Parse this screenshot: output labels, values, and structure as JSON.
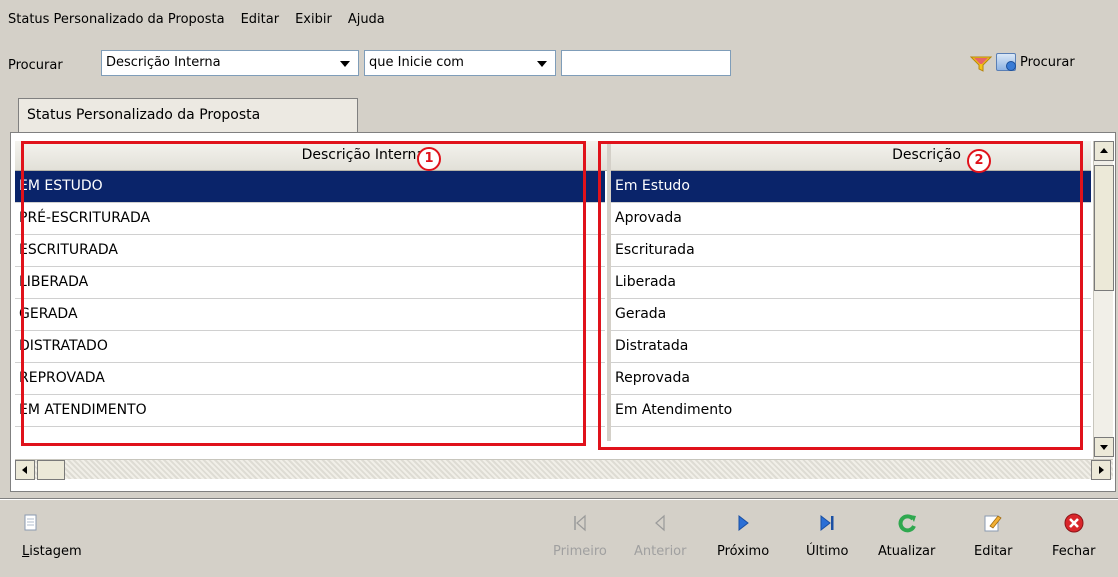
{
  "menu": {
    "items": [
      "Status Personalizado da Proposta",
      "Editar",
      "Exibir",
      "Ajuda"
    ]
  },
  "search": {
    "label": "Procurar",
    "field_value": "Descrição Interna",
    "condition_value": "que Inicie com",
    "text_value": "",
    "button_label": "Procurar"
  },
  "tab": {
    "label": "Status Personalizado da Proposta"
  },
  "table": {
    "columns": [
      "Descrição Interna",
      "Descrição"
    ],
    "rows": [
      [
        "EM ESTUDO",
        "Em Estudo"
      ],
      [
        "PRÉ-ESCRITURADA",
        "Aprovada"
      ],
      [
        "ESCRITURADA",
        "Escriturada"
      ],
      [
        "LIBERADA",
        "Liberada"
      ],
      [
        "GERADA",
        "Gerada"
      ],
      [
        "DISTRATADO",
        "Distratada"
      ],
      [
        "REPROVADA",
        "Reprovada"
      ],
      [
        "EM ATENDIMENTO",
        "Em Atendimento"
      ]
    ],
    "selected_row": 0
  },
  "annotations": [
    "1",
    "2"
  ],
  "toolbar": {
    "listagem": "Listagem",
    "primeiro": "Primeiro",
    "anterior": "Anterior",
    "proximo": "Próximo",
    "ultimo": "Último",
    "atualizar": "Atualizar",
    "editar": "Editar",
    "fechar": "Fechar"
  },
  "colors": {
    "selection": "#0a246a",
    "annotation": "#e0121b",
    "window_bg": "#d4d0c8"
  }
}
